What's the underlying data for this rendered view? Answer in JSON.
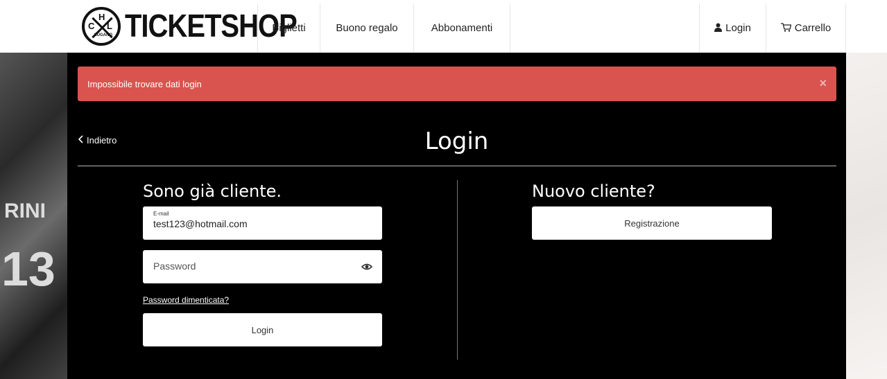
{
  "header": {
    "logo_text": "TICKETSHOP",
    "logo_badge": {
      "h": "H",
      "c": "C",
      "l": "L",
      "sub": "LUGANO"
    },
    "nav": {
      "biglietti": "Biglietti",
      "buono_regalo": "Buono regalo",
      "abbonamenti": "Abbonamenti",
      "login": "Login",
      "carrello": "Carrello"
    }
  },
  "background": {
    "left_numbers": [
      "RINI",
      "13"
    ]
  },
  "alert": {
    "message": "Impossibile trovare dati login",
    "close": "×"
  },
  "main": {
    "back_label": "Indietro",
    "title": "Login",
    "existing_customer": {
      "heading": "Sono già cliente.",
      "email_label": "E-mail",
      "email_value": "test123@hotmail.com",
      "password_placeholder": "Password",
      "forgot_link": "Password dimenticata?",
      "login_button": "Login"
    },
    "new_customer": {
      "heading": "Nuovo cliente?",
      "register_button": "Registrazione"
    }
  },
  "colors": {
    "alert_bg": "#d9534f",
    "panel_bg": "#000000"
  }
}
